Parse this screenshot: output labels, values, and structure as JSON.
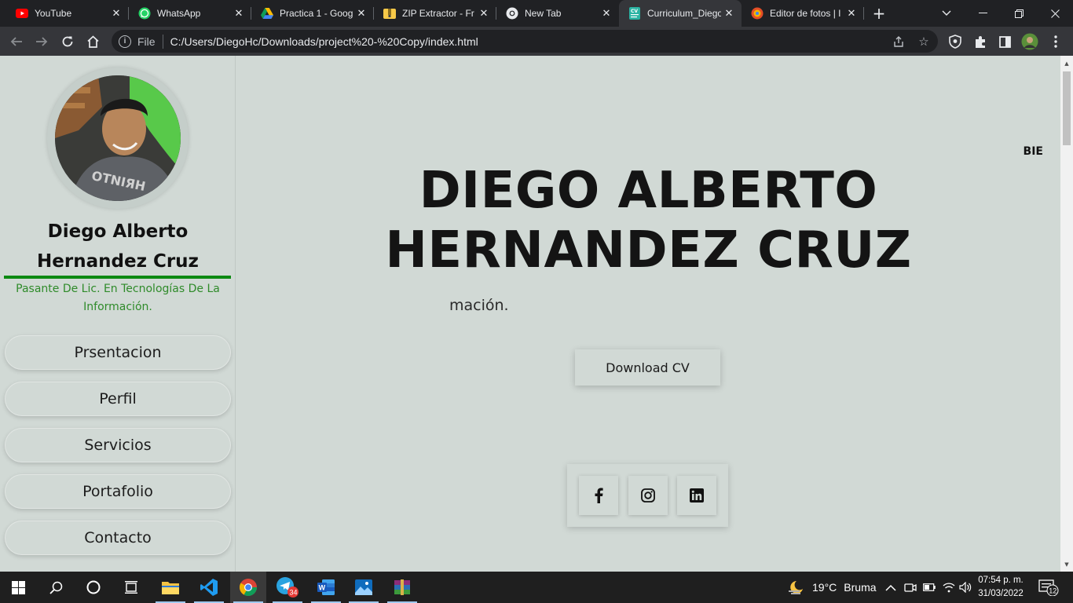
{
  "browser": {
    "tabs": [
      {
        "title": "YouTube",
        "icon": "youtube-icon",
        "active": false
      },
      {
        "title": "WhatsApp",
        "icon": "whatsapp-icon",
        "active": false
      },
      {
        "title": "Practica 1 - Goog",
        "icon": "google-drive-icon",
        "active": false
      },
      {
        "title": "ZIP Extractor - Fr",
        "icon": "zip-extractor-icon",
        "active": false
      },
      {
        "title": "New Tab",
        "icon": "chrome-icon",
        "active": false
      },
      {
        "title": "Curriculum_Diego",
        "icon": "cv-icon",
        "active": true
      },
      {
        "title": "Editor de fotos | I",
        "icon": "photo-editor-icon",
        "active": false
      }
    ],
    "new_tab_label": "+",
    "address": {
      "scheme_label": "File",
      "url": "C:/Users/DiegoHc/Downloads/project%20-%20Copy/index.html"
    }
  },
  "sidebar": {
    "name": "Diego Alberto Hernandez Cruz",
    "role": "Pasante De Lic. En Tecnologías De La Información.",
    "nav": [
      {
        "label": "Prsentacion"
      },
      {
        "label": "Perfil"
      },
      {
        "label": "Servicios"
      },
      {
        "label": "Portafolio"
      },
      {
        "label": "Contacto"
      }
    ]
  },
  "hero": {
    "marquee_text": "BIE",
    "name_heading": "DIEGO ALBERTO HERNANDEZ CRUZ",
    "typed_text": "mación.",
    "download_label": "Download CV",
    "socials": [
      {
        "name": "facebook",
        "icon": "facebook-icon"
      },
      {
        "name": "instagram",
        "icon": "instagram-icon"
      },
      {
        "name": "linkedin",
        "icon": "linkedin-icon"
      }
    ]
  },
  "taskbar": {
    "weather": {
      "temp": "19°C",
      "condition": "Bruma"
    },
    "clock": {
      "time": "07:54 p. m.",
      "date": "31/03/2022"
    },
    "telegram_badge": "34",
    "notifications_badge": "12"
  },
  "colors": {
    "page_bg": "#d1d9d5",
    "accent_green": "#0c8a12",
    "role_text": "#2f8b2a",
    "browser_dark": "#202124",
    "toolbar": "#35363a"
  }
}
